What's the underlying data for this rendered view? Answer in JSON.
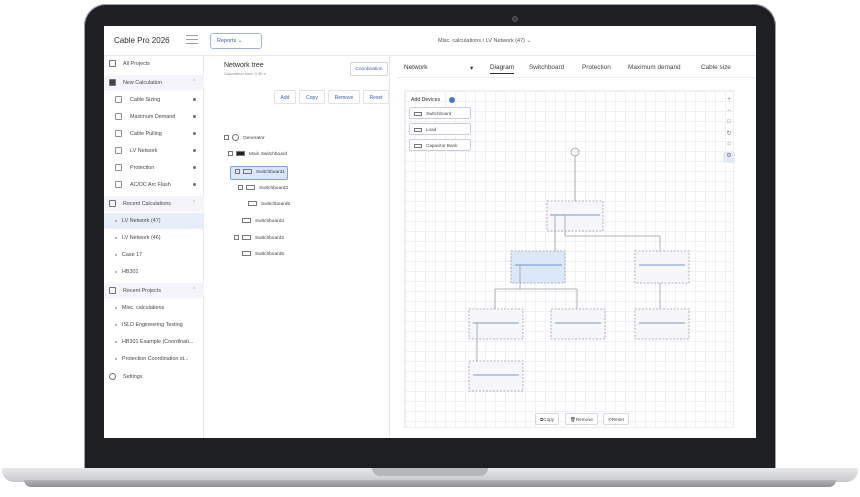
{
  "app": {
    "title": "Cable Pro 2026",
    "reports_label": "Reports ⌄",
    "breadcrumb": "Misc. calculations  /  LV Network (47)  ⌄"
  },
  "sidebar": {
    "all_projects": "All Projects",
    "new_calculation": "New Calculation",
    "calc_items": [
      "Cable Sizing",
      "Maximum Demand",
      "Cable Pulling",
      "LV Network",
      "Protection",
      "AC/DC Arc Flash"
    ],
    "recent_calculations": "Recent Calculations",
    "recent_calc_items": [
      "LV Network (47)",
      "LV Network (46)",
      "Case 17",
      "HB301"
    ],
    "recent_projects": "Recent Projects",
    "recent_project_items": [
      "Misc. calculations",
      "ISLD Engineering Testing",
      "HB301 Example (Coordinati...",
      "Protection Coordination st..."
    ],
    "settings": "Settings"
  },
  "tree": {
    "title": "Network tree",
    "subtitle": "Calculation time: 0.38 s",
    "coordination": "Coordination",
    "actions": [
      "Add",
      "Copy",
      "Remove",
      "Reset"
    ],
    "nodes": [
      "Generator",
      "Main Switchboard",
      "Switchboard1",
      "Switchboard3",
      "Switchboard5",
      "Switchboard4",
      "Switchboard2",
      "Switchboard6"
    ]
  },
  "right": {
    "network_select": "Network",
    "tabs": [
      "Diagram",
      "Switchboard",
      "Protection",
      "Maximum demand",
      "Cable size"
    ],
    "add_devices": "Add Devices",
    "device_buttons": [
      "Switchboard",
      "Load",
      "Capacitor Bank"
    ],
    "bottom_actions": [
      "Copy",
      "Remove",
      "Reset"
    ]
  },
  "colors": {
    "accent": "#3d5da8",
    "selection": "#d9e6fb",
    "bus": "#4a78c8"
  }
}
